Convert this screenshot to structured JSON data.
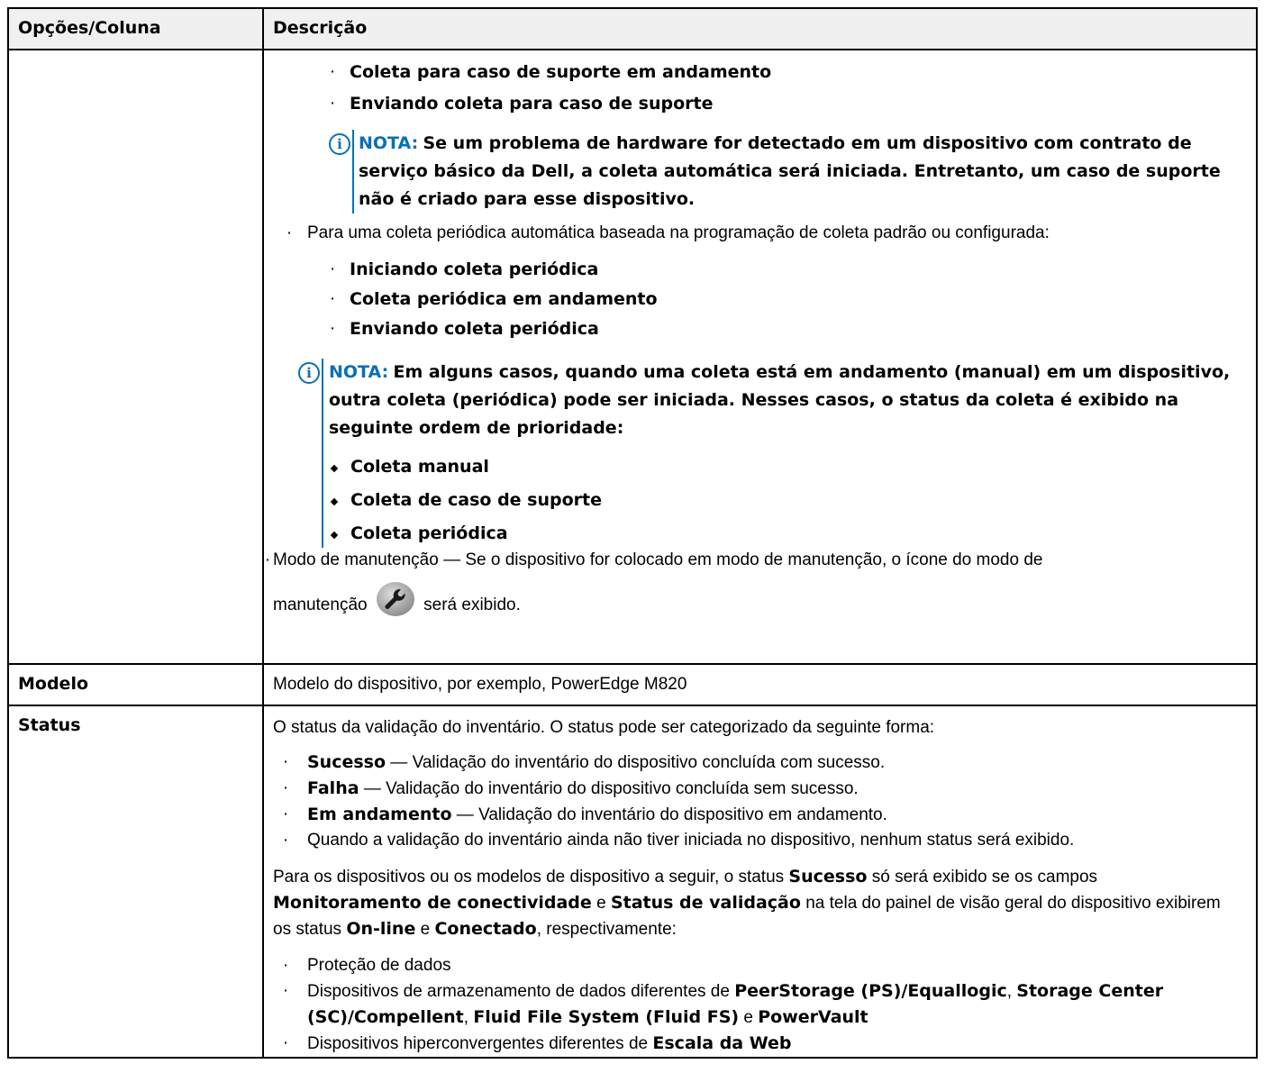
{
  "table": {
    "headers": [
      "Opções/Coluna",
      "Descrição"
    ],
    "row1": {
      "option": "",
      "items_a": [
        "Coleta para caso de suporte em andamento",
        "Enviando coleta para caso de suporte"
      ],
      "note1": {
        "label": "NOTA:",
        "text": "Se um problema de hardware for detectado em um dispositivo com contrato de serviço básico da Dell, a coleta automática será iniciada. Entretanto, um caso de suporte não é criado para esse dispositivo."
      },
      "periodic_intro": "Para uma coleta periódica automática baseada na programação de coleta padrão ou configurada:",
      "items_b": [
        "Iniciando coleta periódica",
        "Coleta periódica em andamento",
        "Enviando coleta periódica"
      ],
      "note2": {
        "label": "NOTA:",
        "text": "Em alguns casos, quando uma coleta está em andamento (manual) em um dispositivo, outra coleta (periódica) pode ser iniciada. Nesses casos, o status da coleta é exibido na seguinte ordem de prioridade:",
        "items": [
          "Coleta manual",
          "Coleta de caso de suporte",
          "Coleta periódica"
        ]
      },
      "maintenance_line1": "Modo de manutenção — Se o dispositivo for colocado em modo de manutenção, o ícone do modo de",
      "maintenance_pre": "manutenção",
      "maintenance_post": "será exibido."
    },
    "row2": {
      "option": "Modelo",
      "description": "Modelo do dispositivo, por exemplo, PowerEdge M820"
    },
    "row3": {
      "option": "Status",
      "intro": "O status da validação do inventário. O status pode ser categorizado da seguinte forma:",
      "statuses": [
        {
          "term": "Sucesso",
          "text": " — Validação do inventário do dispositivo concluída com sucesso."
        },
        {
          "term": "Falha",
          "text": " — Validação do inventário do dispositivo concluída sem sucesso."
        },
        {
          "term": "Em andamento",
          "text": " — Validação do inventário do dispositivo em andamento."
        }
      ],
      "status_none": "Quando a validação do inventário ainda não tiver iniciada no dispositivo, nenhum status será exibido.",
      "para": {
        "t1": "Para os dispositivos ou os modelos de dispositivo a seguir, o status ",
        "b1": "Sucesso",
        "t2": " só será exibido se os campos ",
        "b2": "Monitoramento de conectividade",
        "t3": " e ",
        "b3": "Status de validação",
        "t4": " na tela do painel de visão geral do dispositivo exibirem os status ",
        "b4": "On-line",
        "t5": " e ",
        "b5": "Conectado",
        "t6": ", respectivamente:"
      },
      "list1": "Proteção de dados",
      "list2": {
        "t1": "Dispositivos de armazenamento de dados diferentes de ",
        "b1": "PeerStorage (PS)/Equallogic",
        "t2": ", ",
        "b2": "Storage Center (SC)/Compellent",
        "t3": ", ",
        "b3": "Fluid File System (Fluid FS)",
        "t4": " e ",
        "b4": "PowerVault"
      },
      "list3": {
        "t1": "Dispositivos hiperconvergentes diferentes de ",
        "b1": "Escala da Web"
      }
    },
    "bullet_char": "·",
    "info_char": "i"
  }
}
